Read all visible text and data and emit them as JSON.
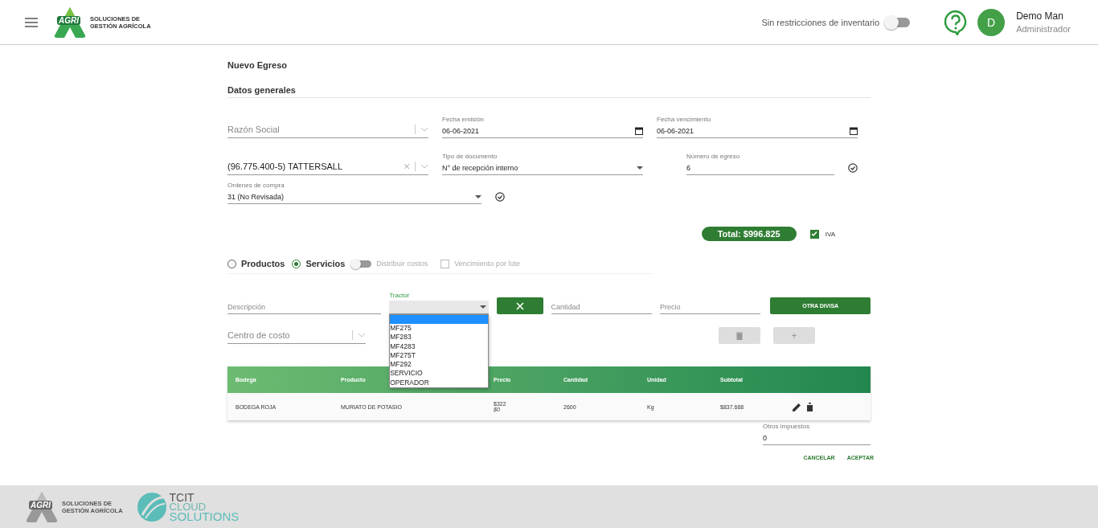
{
  "header": {
    "logo_text": "AGRI",
    "logo_caption": [
      "SOLUCIONES DE",
      "GESTIÓN AGRÍCOLA"
    ],
    "inventory_toggle": {
      "label": "Sin restricciones de inventario",
      "on": false
    },
    "user": {
      "initial": "D",
      "name": "Demo Man",
      "role": "Administrador"
    }
  },
  "title": "Nuevo Egreso",
  "section": "Datos generales",
  "razon_social": {
    "placeholder": "Razón Social"
  },
  "fecha_emision": {
    "label": "Fecha emisión",
    "value": "06-06-2021"
  },
  "fecha_vencimiento": {
    "label": "Fecha vencimiento",
    "value": "06-06-2021"
  },
  "proveedor": {
    "value": "(96.775.400-5) TATTERSALL"
  },
  "tipo_documento": {
    "label": "Tipo de documento",
    "value": "N° de recepción interno"
  },
  "numero_egreso": {
    "label": "Número de egreso",
    "value": "6"
  },
  "ordenes_compra": {
    "label": "Ordenes de compra",
    "value": "31 (No Revisada)"
  },
  "total": "Total: $996.825",
  "iva": {
    "label": "IVA",
    "checked": true
  },
  "modes": [
    {
      "label": "Productos",
      "selected": false
    },
    {
      "label": "Servicios",
      "selected": true
    }
  ],
  "distribuir": {
    "label": "Distribuir costos",
    "on": false
  },
  "vencimiento_lote": {
    "label": "Vencimiento por lote",
    "checked": false
  },
  "descripcion": {
    "placeholder": "Descripción"
  },
  "tractor": {
    "label": "Tractor",
    "options": [
      "MF275",
      "MF283",
      "MF4283",
      "MF275T",
      "MF292",
      "SERVICIO",
      "OPERADOR"
    ]
  },
  "cantidad": {
    "placeholder": "Cantidad"
  },
  "precio": {
    "placeholder": "Precio"
  },
  "otra_divisa": "OTRA DIVISA",
  "centro_costo": {
    "placeholder": "Centro de costo"
  },
  "add_button": "+",
  "table": {
    "columns": [
      "Bodega",
      "Producto",
      "Precio",
      "Cantidad",
      "Unidad",
      "Subtotal"
    ],
    "rows": [
      {
        "bodega": "BODEGA ROJA",
        "producto": "MURIATO DE POTASIO",
        "precio": [
          "$322",
          "$0"
        ],
        "cantidad": "2600",
        "unidad": "Kg",
        "subtotal": "$837.668"
      }
    ]
  },
  "otros_impuestos": {
    "label": "Otros impuestos",
    "value": "0"
  },
  "actions": [
    "CANCELAR",
    "ACEPTAR"
  ],
  "footer": {
    "agri_text": "AGRI",
    "agri_caption": [
      "SOLUCIONES DE",
      "GESTIÓN AGRÍCOLA"
    ],
    "tcit": [
      "TCIT",
      "CLOUD",
      "SOLUTIONS"
    ]
  }
}
